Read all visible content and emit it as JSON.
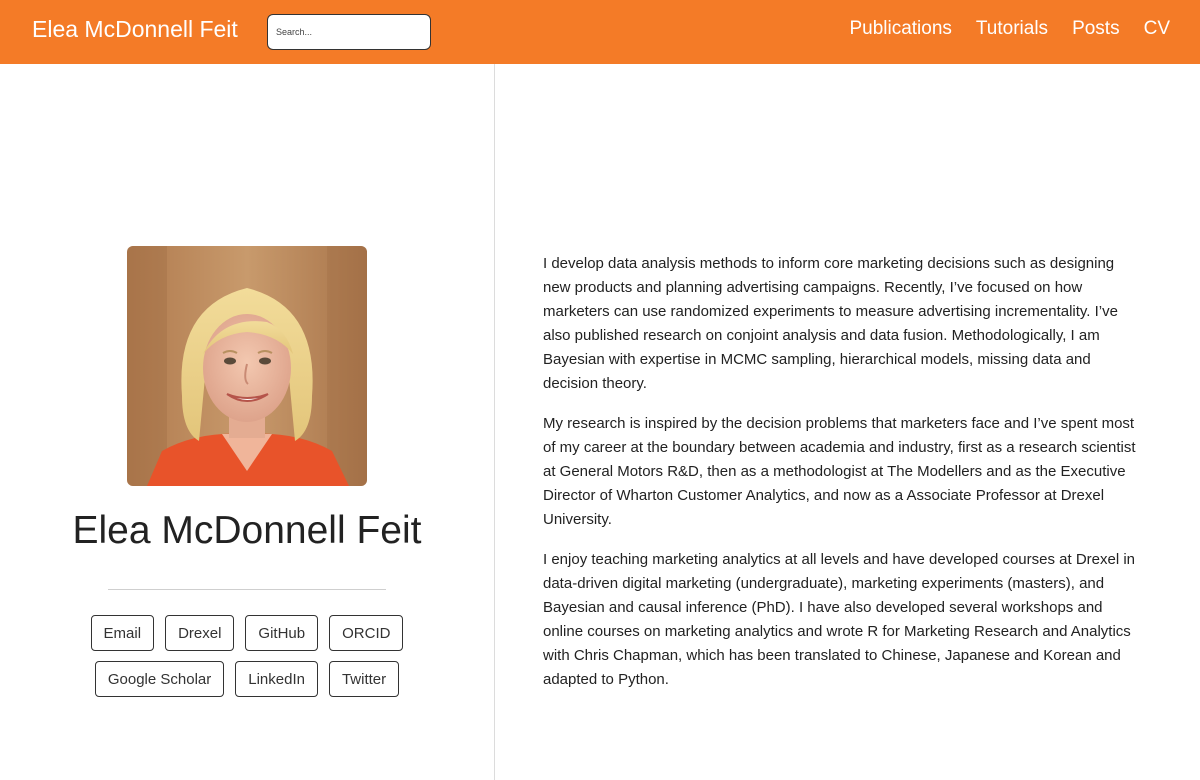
{
  "navbar": {
    "brand": "Elea McDonnell Feit",
    "search_placeholder": "Search...",
    "links": [
      {
        "label": "Publications"
      },
      {
        "label": "Tutorials"
      },
      {
        "label": "Posts"
      },
      {
        "label": "CV"
      }
    ],
    "background_color": "#f47b27"
  },
  "profile": {
    "name": "Elea McDonnell Feit",
    "links_row1": [
      {
        "label": "Email"
      },
      {
        "label": "Drexel"
      },
      {
        "label": "GitHub"
      },
      {
        "label": "ORCID"
      }
    ],
    "links_row2": [
      {
        "label": "Google Scholar"
      },
      {
        "label": "LinkedIn"
      },
      {
        "label": "Twitter"
      }
    ]
  },
  "bio": {
    "paragraphs": [
      "I develop data analysis methods to inform core marketing decisions such as designing new products and planning advertising campaigns. Recently, I’ve focused on how marketers can use randomized experiments to measure advertising incrementality. I’ve also published research on conjoint analysis and data fusion. Methodologically, I am Bayesian with expertise in MCMC sampling, hierarchical models, missing data and decision theory.",
      "My research is inspired by the decision problems that marketers face and I’ve spent most of my career at the boundary between academia and industry, first as a research scientist at General Motors R&D, then as a methodologist at The Modellers and as the Executive Director of Wharton Customer Analytics, and now as a Associate Professor at Drexel University.",
      "I enjoy teaching marketing analytics at all levels and have developed courses at Drexel in data-driven digital marketing (undergraduate), marketing experiments (masters), and Bayesian and causal inference (PhD). I have also developed several workshops and online courses on marketing analytics and wrote R for Marketing Research and Analytics with Chris Chapman, which has been translated to Chinese, Japanese and Korean and adapted to Python."
    ]
  }
}
